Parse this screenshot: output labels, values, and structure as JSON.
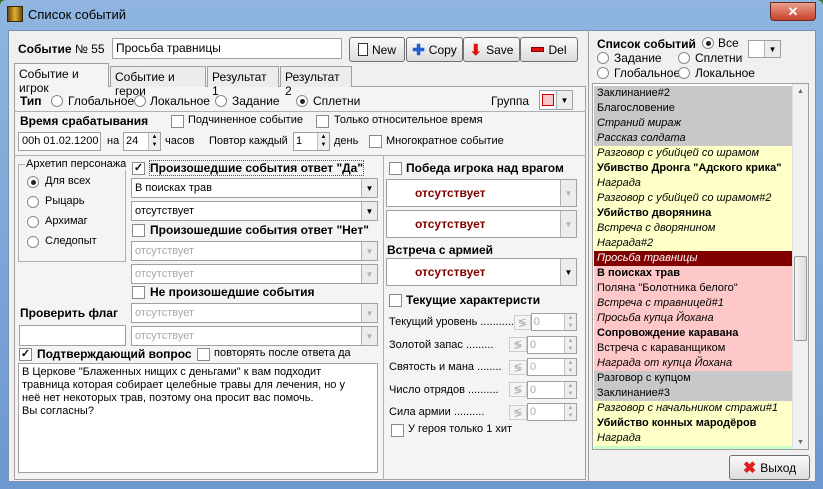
{
  "window": {
    "title": "Список событий",
    "close": "✕"
  },
  "header": {
    "event_label": "Событие",
    "number_label": "№ 55",
    "name": "Просьба травницы"
  },
  "toolbar": {
    "new": "New",
    "copy": "Copy",
    "save": "Save",
    "del": "Del"
  },
  "tabs": [
    "Событие и игрок",
    "Событие и герои",
    "Результат 1",
    "Результат 2"
  ],
  "type": {
    "label": "Тип",
    "options": [
      "Глобальное",
      "Локальное",
      "Задание",
      "Сплетни"
    ],
    "selected": "Сплетни",
    "group_label": "Группа",
    "group_color": "#f8c8c8"
  },
  "time": {
    "label": "Время срабатывания",
    "sub_event": "Подчиненное событие",
    "relative_only": "Только относительное время",
    "start": "00h 01.02.1200",
    "on": "на",
    "hours_value": "24",
    "hours": "часов",
    "repeat_label": "Повтор каждый",
    "repeat_value": "1",
    "day": "день",
    "multiple": "Многократное событие"
  },
  "archetype": {
    "label": "Архетип персонажа",
    "options": [
      "Для всех",
      "Рыцарь",
      "Архимаг",
      "Следопыт"
    ],
    "selected": "Для всех"
  },
  "events_yes": {
    "label": "Произошедшие события ответ \"Да\"",
    "checked": true,
    "combo1": "В поисках трав",
    "combo2": "отсутствует"
  },
  "events_no": {
    "label": "Произошедшие события ответ \"Нет\"",
    "checked": false,
    "combo1": "отсутствует",
    "combo2": "отсутствует"
  },
  "not_happened": {
    "label": "Не произошедшие события",
    "checked": false,
    "combo1": "отсутствует",
    "combo2": "отсутствует"
  },
  "flag": {
    "label": "Проверить флаг",
    "value": ""
  },
  "confirm": {
    "label": "Подтверждающий вопрос",
    "checked": true,
    "repeat": "повторять после ответа да",
    "text": "В Церкове \"Блаженных нищих с деньгами\" к вам подходит травница которая собирает целебные травы для лечения, но у неё нет некоторых трав, поэтому она просит вас помочь.\nВы согласны?"
  },
  "victory": {
    "label": "Победа игрока над врагом",
    "combo1": "отсутствует",
    "combo2": "отсутствует"
  },
  "army": {
    "label": "Встреча с армией",
    "combo": "отсутствует"
  },
  "stats": {
    "label": "Текущие характеристи",
    "rows": [
      {
        "label": "Текущий уровень ...........",
        "value": "0"
      },
      {
        "label": "Золотой запас .........",
        "value": "0"
      },
      {
        "label": "Святость и мана ........",
        "value": "0"
      },
      {
        "label": "Число отрядов ..........",
        "value": "0"
      },
      {
        "label": "Сила армии ..........",
        "value": "0"
      }
    ],
    "one_hp": "У героя только 1 хит"
  },
  "event_list": {
    "title": "Список событий",
    "filters": [
      "Все",
      "Задание",
      "Сплетни",
      "Глобальное",
      "Локальное"
    ],
    "selected": "Все",
    "colors": {
      "gray": "#c8c8c8",
      "yellow": "#ffffc8",
      "pink": "#ffc8c8",
      "selected": "#800000",
      "green": "#c8ffc8"
    },
    "items": [
      {
        "t": "Заклинание#2",
        "c": "gray",
        "s": "n"
      },
      {
        "t": "Благословение",
        "c": "gray",
        "s": "n"
      },
      {
        "t": "Страний мираж",
        "c": "gray",
        "s": "i"
      },
      {
        "t": "Рассказ солдата",
        "c": "gray",
        "s": "i"
      },
      {
        "t": "Разговор с убийцей со шрамом",
        "c": "yellow",
        "s": "i"
      },
      {
        "t": "Убивство Дронга \"Адского крика\"",
        "c": "yellow",
        "s": "b"
      },
      {
        "t": "Награда",
        "c": "yellow",
        "s": "i"
      },
      {
        "t": "Разговор с убийцей со шрамом#2",
        "c": "yellow",
        "s": "i"
      },
      {
        "t": "Убийство дворянина",
        "c": "yellow",
        "s": "b"
      },
      {
        "t": "Встреча с  дворянином",
        "c": "yellow",
        "s": "i"
      },
      {
        "t": "Награда#2",
        "c": "yellow",
        "s": "i"
      },
      {
        "t": "Просьба травницы",
        "c": "selected",
        "s": "i"
      },
      {
        "t": "В поисках трав",
        "c": "pink",
        "s": "b"
      },
      {
        "t": "Поляна \"Болотника белого\"",
        "c": "pink",
        "s": "n"
      },
      {
        "t": "Встреча с травницей#1",
        "c": "pink",
        "s": "i"
      },
      {
        "t": "Просьба купца Йохана",
        "c": "pink",
        "s": "i"
      },
      {
        "t": "Сопровождение каравана",
        "c": "pink",
        "s": "b"
      },
      {
        "t": "Встреча с караванщиком",
        "c": "pink",
        "s": "n"
      },
      {
        "t": "Награда от купца Йохана",
        "c": "pink",
        "s": "i"
      },
      {
        "t": "Разговор с купцом",
        "c": "gray",
        "s": "n"
      },
      {
        "t": "Заклинание#3",
        "c": "gray",
        "s": "n"
      },
      {
        "t": "Разговор с начальником стражи#1",
        "c": "yellow",
        "s": "i"
      },
      {
        "t": "Убийство конных мародёров",
        "c": "yellow",
        "s": "b"
      },
      {
        "t": "Награда",
        "c": "yellow",
        "s": "i"
      },
      {
        "t": "",
        "c": "green",
        "s": "n"
      }
    ]
  },
  "exit": "Выход"
}
